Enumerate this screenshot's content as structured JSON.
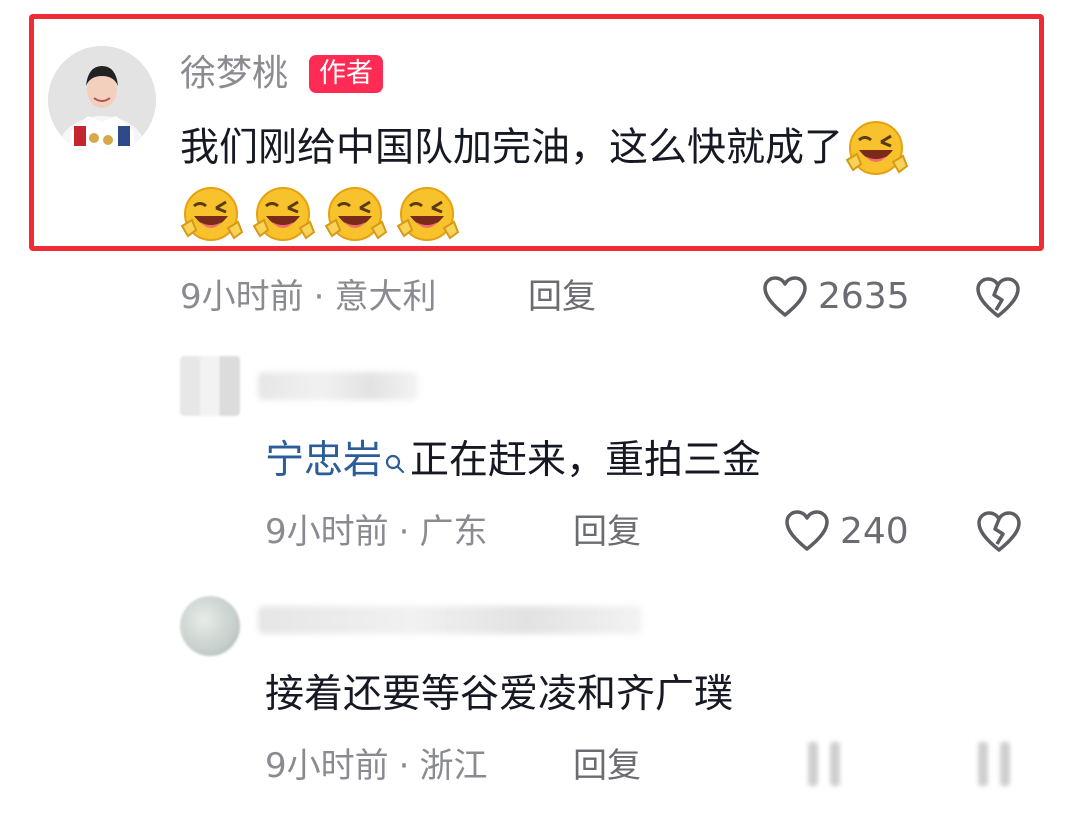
{
  "comment": {
    "author": "徐梦桃",
    "badge": "作者",
    "text": "我们刚给中国队加完油，这么快就成了",
    "emoji_name": "grinning-squinting-face-emoji",
    "time": "9小时前",
    "location": "意大利",
    "reply_label": "回复",
    "likes": "2635"
  },
  "replies": [
    {
      "mention": "宁忠岩",
      "text": "正在赶来，重拍三金",
      "time": "9小时前",
      "location": "广东",
      "reply_label": "回复",
      "likes": "240"
    },
    {
      "text": "接着还要等谷爱凌和齐广璞",
      "time": "9小时前",
      "location": "浙江",
      "reply_label": "回复"
    }
  ],
  "separator": "·",
  "colors": {
    "highlight_border": "#ef2b34",
    "badge_bg": "#fe2c55",
    "mention": "#2a5d9a",
    "meta_text": "#8a8b91"
  },
  "icons": [
    "heart-outline-icon",
    "broken-heart-icon",
    "search-icon"
  ]
}
